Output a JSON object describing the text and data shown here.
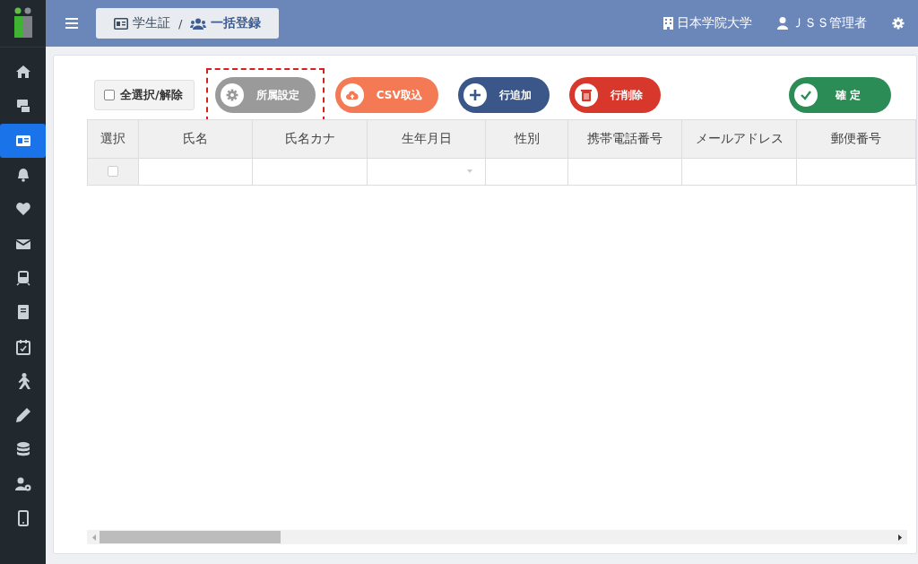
{
  "sidebar": {
    "items": [
      {
        "kind": "home",
        "selected": false
      },
      {
        "kind": "devices",
        "selected": false
      },
      {
        "kind": "id-card",
        "selected": true
      },
      {
        "kind": "bell",
        "selected": false
      },
      {
        "kind": "heartbeat",
        "selected": false
      },
      {
        "kind": "envelope",
        "selected": false
      },
      {
        "kind": "train",
        "selected": false
      },
      {
        "kind": "book",
        "selected": false
      },
      {
        "kind": "calendar",
        "selected": false
      },
      {
        "kind": "walker",
        "selected": false
      },
      {
        "kind": "pencil",
        "selected": false
      },
      {
        "kind": "database",
        "selected": false
      },
      {
        "kind": "user-gear",
        "selected": false
      },
      {
        "kind": "mobile",
        "selected": false
      }
    ]
  },
  "header": {
    "breadcrumb": [
      "学生証",
      "一括登録"
    ],
    "separator": "/",
    "school": "日本学院大学",
    "user": "ＪＳＳ管理者"
  },
  "toolbar": {
    "select_all": {
      "label": "全選択/解除",
      "checked": false
    },
    "buttons": [
      {
        "kind": "settings",
        "label": "所属設定",
        "highlighted": true
      },
      {
        "kind": "csv",
        "label": "CSV取込",
        "highlighted": false
      },
      {
        "kind": "add",
        "label": "行追加",
        "highlighted": false
      },
      {
        "kind": "delete",
        "label": "行削除",
        "highlighted": false
      },
      {
        "kind": "confirm",
        "label": "確 定",
        "highlighted": false
      }
    ]
  },
  "table": {
    "columns": [
      "選択",
      "氏名",
      "氏名カナ",
      "生年月日",
      "性別",
      "携帯電話番号",
      "メールアドレス",
      "郵便番号"
    ],
    "rows": [
      {
        "checked": false,
        "cells": [
          {
            "kind": "checkbox"
          },
          {
            "kind": "text"
          },
          {
            "kind": "text"
          },
          {
            "kind": "select"
          },
          {
            "kind": "text"
          },
          {
            "kind": "text"
          },
          {
            "kind": "text"
          },
          {
            "kind": "text"
          }
        ]
      }
    ]
  }
}
